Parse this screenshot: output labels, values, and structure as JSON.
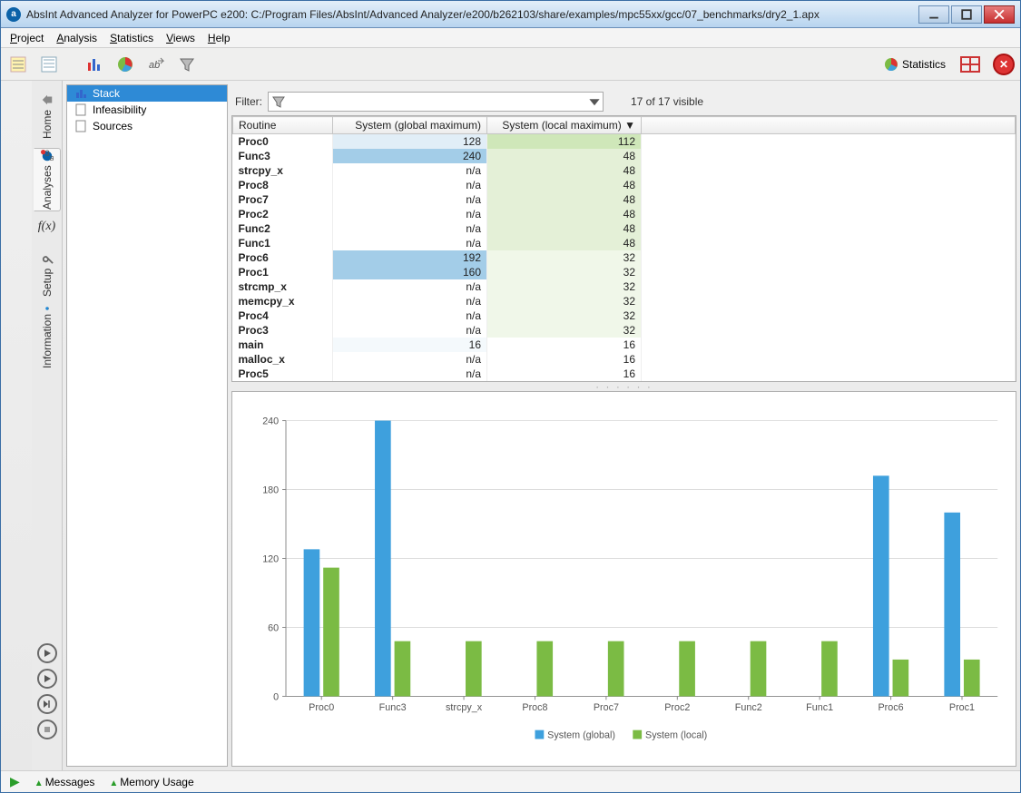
{
  "window": {
    "title": "AbsInt Advanced Analyzer for PowerPC e200: C:/Program Files/AbsInt/Advanced Analyzer/e200/b262103/share/examples/mpc55xx/gcc/07_benchmarks/dry2_1.apx"
  },
  "menu": {
    "project": "Project",
    "analysis": "Analysis",
    "statistics": "Statistics",
    "views": "Views",
    "help": "Help"
  },
  "toolbar": {
    "stats_label": "Statistics"
  },
  "side_tabs": {
    "home": "Home",
    "analyses": "Analyses",
    "setup": "Setup",
    "information": "Information"
  },
  "nav": {
    "stack": "Stack",
    "infeasibility": "Infeasibility",
    "sources": "Sources"
  },
  "filter": {
    "label": "Filter:",
    "count": "17 of 17 visible"
  },
  "table": {
    "cols": {
      "routine": "Routine",
      "global": "System (global maximum)",
      "local": "System (local maximum)"
    },
    "rows": [
      {
        "r": "Proc0",
        "g": "128",
        "l": "112",
        "gc": "blue2",
        "lc": "g1"
      },
      {
        "r": "Func3",
        "g": "240",
        "l": "48",
        "gc": "blue1",
        "lc": "g2"
      },
      {
        "r": "strcpy_x",
        "g": "n/a",
        "l": "48",
        "gc": "",
        "lc": "g2"
      },
      {
        "r": "Proc8",
        "g": "n/a",
        "l": "48",
        "gc": "",
        "lc": "g2"
      },
      {
        "r": "Proc7",
        "g": "n/a",
        "l": "48",
        "gc": "",
        "lc": "g2"
      },
      {
        "r": "Proc2",
        "g": "n/a",
        "l": "48",
        "gc": "",
        "lc": "g2"
      },
      {
        "r": "Func2",
        "g": "n/a",
        "l": "48",
        "gc": "",
        "lc": "g2"
      },
      {
        "r": "Func1",
        "g": "n/a",
        "l": "48",
        "gc": "",
        "lc": "g2"
      },
      {
        "r": "Proc6",
        "g": "192",
        "l": "32",
        "gc": "blue1",
        "lc": "g3"
      },
      {
        "r": "Proc1",
        "g": "160",
        "l": "32",
        "gc": "blue1",
        "lc": "g3"
      },
      {
        "r": "strcmp_x",
        "g": "n/a",
        "l": "32",
        "gc": "",
        "lc": "g3"
      },
      {
        "r": "memcpy_x",
        "g": "n/a",
        "l": "32",
        "gc": "",
        "lc": "g3"
      },
      {
        "r": "Proc4",
        "g": "n/a",
        "l": "32",
        "gc": "",
        "lc": "g3"
      },
      {
        "r": "Proc3",
        "g": "n/a",
        "l": "32",
        "gc": "",
        "lc": "g3"
      },
      {
        "r": "main",
        "g": "16",
        "l": "16",
        "gc": "blue3",
        "lc": ""
      },
      {
        "r": "malloc_x",
        "g": "n/a",
        "l": "16",
        "gc": "",
        "lc": ""
      },
      {
        "r": "Proc5",
        "g": "n/a",
        "l": "16",
        "gc": "",
        "lc": ""
      }
    ]
  },
  "chart_data": {
    "type": "bar",
    "categories": [
      "Proc0",
      "Func3",
      "strcpy_x",
      "Proc8",
      "Proc7",
      "Proc2",
      "Func2",
      "Func1",
      "Proc6",
      "Proc1"
    ],
    "series": [
      {
        "name": "System (global)",
        "color": "#3ea0dd",
        "values": [
          128,
          240,
          null,
          null,
          null,
          null,
          null,
          null,
          192,
          160
        ]
      },
      {
        "name": "System (local)",
        "color": "#7bbb44",
        "values": [
          112,
          48,
          48,
          48,
          48,
          48,
          48,
          48,
          32,
          32
        ]
      }
    ],
    "yticks": [
      0,
      60,
      120,
      180,
      240
    ],
    "ylim": [
      0,
      240
    ]
  },
  "status": {
    "messages": "Messages",
    "memory": "Memory Usage"
  }
}
